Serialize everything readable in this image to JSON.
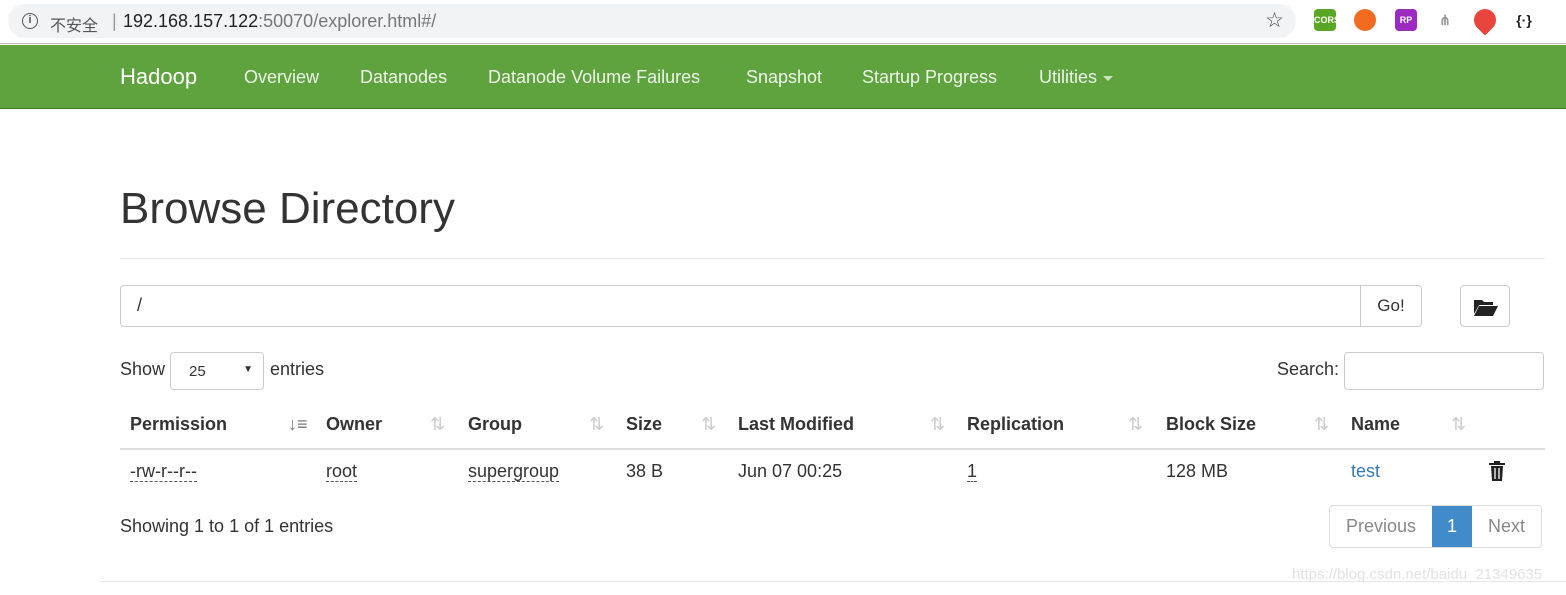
{
  "browser": {
    "insecure_label": "不安全",
    "url_host": "192.168.157.122",
    "url_rest": ":50070/explorer.html#/",
    "extensions": [
      {
        "name": "cors-extension-icon",
        "label": "CORS",
        "color": "#5aa625"
      },
      {
        "name": "orange-extension-icon",
        "label": "",
        "color": "#f26b21"
      },
      {
        "name": "rp-extension-icon",
        "label": "RP",
        "color": "#9b2bc0"
      },
      {
        "name": "sitemap-extension-icon",
        "label": "",
        "color": "#999999"
      },
      {
        "name": "location-extension-icon",
        "label": "",
        "color": "#e8453c"
      },
      {
        "name": "json-extension-icon",
        "label": "{·}",
        "color": "#222222"
      }
    ]
  },
  "nav": {
    "brand": "Hadoop",
    "items": [
      "Overview",
      "Datanodes",
      "Datanode Volume Failures",
      "Snapshot",
      "Startup Progress",
      "Utilities"
    ],
    "color": "#5fa33e"
  },
  "page": {
    "title": "Browse Directory",
    "path": "/",
    "go_label": "Go!"
  },
  "table_controls": {
    "show_label": "Show",
    "entries_value": "25",
    "entries_label": "entries",
    "search_label": "Search:",
    "search_value": ""
  },
  "table": {
    "columns": [
      "Permission",
      "Owner",
      "Group",
      "Size",
      "Last Modified",
      "Replication",
      "Block Size",
      "Name"
    ],
    "rows": [
      {
        "permission": "-rw-r--r--",
        "owner": "root",
        "group": "supergroup",
        "size": "38 B",
        "last_modified": "Jun 07 00:25",
        "replication": "1",
        "block_size": "128 MB",
        "name": "test"
      }
    ]
  },
  "footer": {
    "info": "Showing 1 to 1 of 1 entries",
    "previous": "Previous",
    "page": "1",
    "next": "Next"
  },
  "watermark": "https://blog.csdn.net/baidu_21349635"
}
